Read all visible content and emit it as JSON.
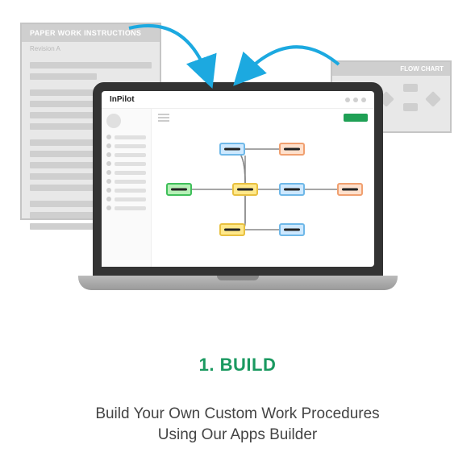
{
  "paper": {
    "title": "PAPER WORK INSTRUCTIONS",
    "revision": "Revision A"
  },
  "flowchart": {
    "title": "FLOW CHART"
  },
  "laptop": {
    "brand": "InPilot"
  },
  "section": {
    "heading": "1. BUILD",
    "line1": "Build Your Own Custom Work Procedures",
    "line2": "Using Our Apps Builder"
  },
  "colors": {
    "accent": "#1a9960",
    "arrow": "#1ca9e0"
  }
}
